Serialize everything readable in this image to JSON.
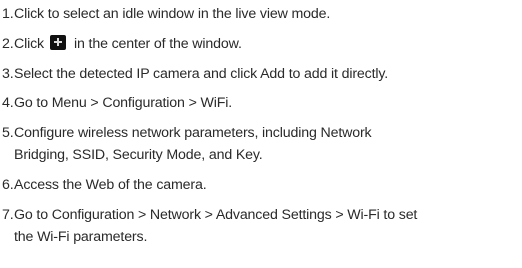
{
  "steps": [
    {
      "num": "1.",
      "text": "Click to select an idle window in the live view mode."
    },
    {
      "num": "2.",
      "before": "Click",
      "icon": "add-icon",
      "after": "in the center of the window."
    },
    {
      "num": "3.",
      "text": "Select the detected IP camera and click Add to add it directly."
    },
    {
      "num": "4.",
      "text": "Go to Menu > Configuration > WiFi."
    },
    {
      "num": "5.",
      "line1": "Configure wireless network parameters, including Network",
      "line2": "Bridging, SSID, Security Mode, and Key."
    },
    {
      "num": "6.",
      "text": "Access the Web of the camera."
    },
    {
      "num": "7.",
      "line1": "Go to Configuration > Network > Advanced Settings > Wi-Fi to set",
      "line2": "the Wi-Fi parameters."
    }
  ]
}
